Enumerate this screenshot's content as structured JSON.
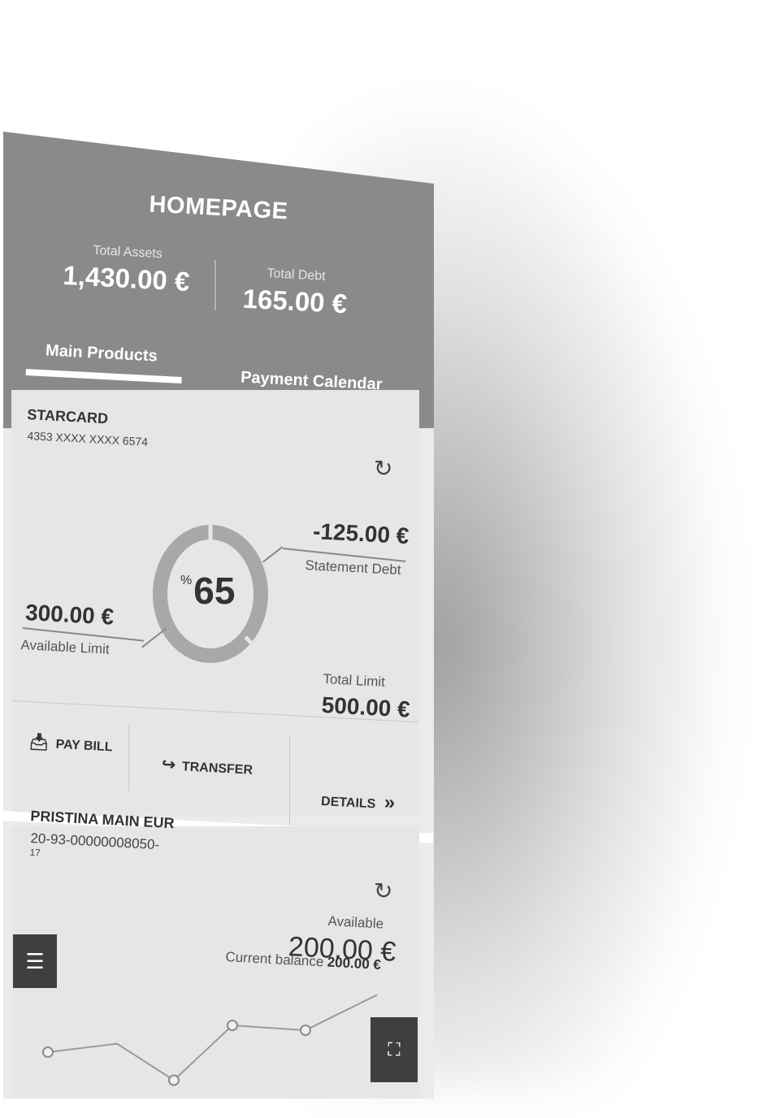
{
  "header": {
    "title": "HOMEPAGE",
    "total_assets_label": "Total Assets",
    "total_assets_value": "1,430.00 €",
    "total_debt_label": "Total Debt",
    "total_debt_value": "165.00 €"
  },
  "tabs": [
    {
      "label": "Main Products",
      "active": true
    },
    {
      "label": "Payment Calendar",
      "active": false
    }
  ],
  "card1": {
    "name": "STARCARD",
    "number": "4353 XXXX XXXX 6574",
    "refresh_icon": "refresh-icon",
    "statement_debt_value": "-125.00 €",
    "statement_debt_label": "Statement Debt",
    "available_limit_value": "300.00 €",
    "available_limit_label": "Available Limit",
    "total_limit_label": "Total Limit",
    "total_limit_value": "500.00 €",
    "usage_percent_symbol": "%",
    "usage_percent": "65",
    "actions": {
      "pay_bill": "PAY BILL",
      "transfer": "TRANSFER",
      "details": "DETAILS",
      "details_chevron": "»"
    }
  },
  "card2": {
    "name": "PRISTINA MAIN EUR",
    "iban_line1": "20-93-00000008050-",
    "iban_line2": "17",
    "available_label": "Available",
    "available_value": "200.00 €",
    "current_balance_label": "Current balance",
    "current_balance_value": "200.00 €",
    "chart_points": [
      0.62,
      0.55,
      0.85,
      0.4,
      0.44,
      0.15
    ]
  },
  "colors": {
    "header_bg": "#8a8a8a",
    "card_bg": "#e6e6e6",
    "fab_bg": "#3f3f3f"
  },
  "icons": {
    "menu": "menu-icon",
    "scan": "scan-icon",
    "pay": "download-tray-icon",
    "transfer": "share-arrow-icon"
  }
}
